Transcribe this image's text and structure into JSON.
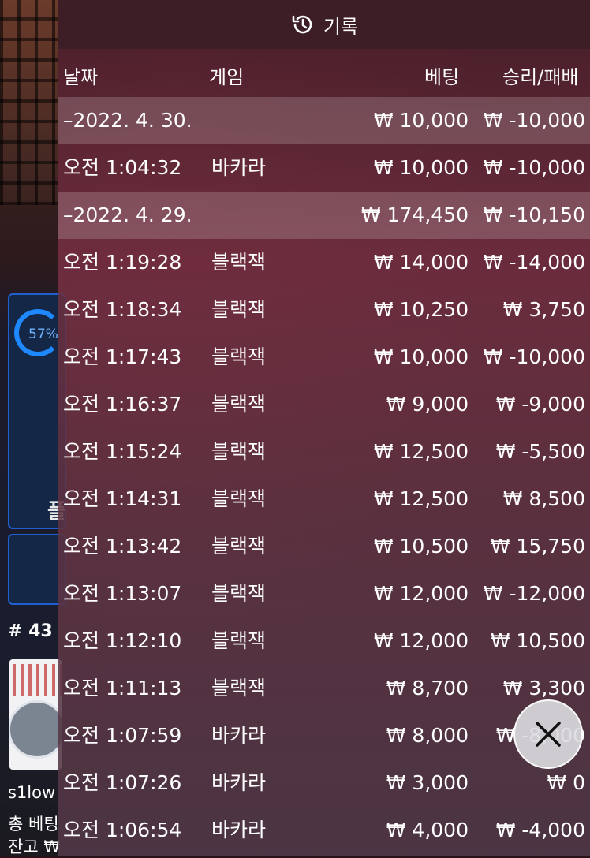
{
  "header": {
    "title": "기록"
  },
  "columns": {
    "date": "날짜",
    "game": "게임",
    "bet": "베팅",
    "result": "승리/패배"
  },
  "rows": [
    {
      "type": "date",
      "time": "–2022. 4. 30.",
      "game": "",
      "bet": "₩ 10,000",
      "result": "₩ -10,000"
    },
    {
      "type": "entry",
      "time": "오전 1:04:32",
      "game": "바카라",
      "bet": "₩ 10,000",
      "result": "₩ -10,000"
    },
    {
      "type": "date",
      "time": "–2022. 4. 29.",
      "game": "",
      "bet": "₩ 174,450",
      "result": "₩ -10,150"
    },
    {
      "type": "entry",
      "time": "오전 1:19:28",
      "game": "블랙잭",
      "bet": "₩ 14,000",
      "result": "₩ -14,000"
    },
    {
      "type": "entry",
      "time": "오전 1:18:34",
      "game": "블랙잭",
      "bet": "₩ 10,250",
      "result": "₩ 3,750"
    },
    {
      "type": "entry",
      "time": "오전 1:17:43",
      "game": "블랙잭",
      "bet": "₩ 10,000",
      "result": "₩ -10,000"
    },
    {
      "type": "entry",
      "time": "오전 1:16:37",
      "game": "블랙잭",
      "bet": "₩ 9,000",
      "result": "₩ -9,000"
    },
    {
      "type": "entry",
      "time": "오전 1:15:24",
      "game": "블랙잭",
      "bet": "₩ 12,500",
      "result": "₩ -5,500"
    },
    {
      "type": "entry",
      "time": "오전 1:14:31",
      "game": "블랙잭",
      "bet": "₩ 12,500",
      "result": "₩ 8,500"
    },
    {
      "type": "entry",
      "time": "오전 1:13:42",
      "game": "블랙잭",
      "bet": "₩ 10,500",
      "result": "₩ 15,750"
    },
    {
      "type": "entry",
      "time": "오전 1:13:07",
      "game": "블랙잭",
      "bet": "₩ 12,000",
      "result": "₩ -12,000"
    },
    {
      "type": "entry",
      "time": "오전 1:12:10",
      "game": "블랙잭",
      "bet": "₩ 12,000",
      "result": "₩ 10,500"
    },
    {
      "type": "entry",
      "time": "오전 1:11:13",
      "game": "블랙잭",
      "bet": "₩ 8,700",
      "result": "₩ 3,300"
    },
    {
      "type": "entry",
      "time": "오전 1:07:59",
      "game": "바카라",
      "bet": "₩ 8,000",
      "result": "₩ -8,000"
    },
    {
      "type": "entry",
      "time": "오전 1:07:26",
      "game": "바카라",
      "bet": "₩ 3,000",
      "result": "₩ 0"
    },
    {
      "type": "entry",
      "time": "오전 1:06:54",
      "game": "바카라",
      "bet": "₩ 4,000",
      "result": "₩ -4,000"
    }
  ],
  "background": {
    "percent": "57%",
    "round": "# 43",
    "user": "s1low",
    "total_bet": "총 베팅",
    "balance": "잔고 ₩"
  },
  "colors": {
    "accent_blue": "#1f5fd0",
    "date_row": "rgba(255,255,255,0.18)"
  },
  "icons": {
    "history": "history-clock-icon",
    "close": "close-x-icon"
  }
}
